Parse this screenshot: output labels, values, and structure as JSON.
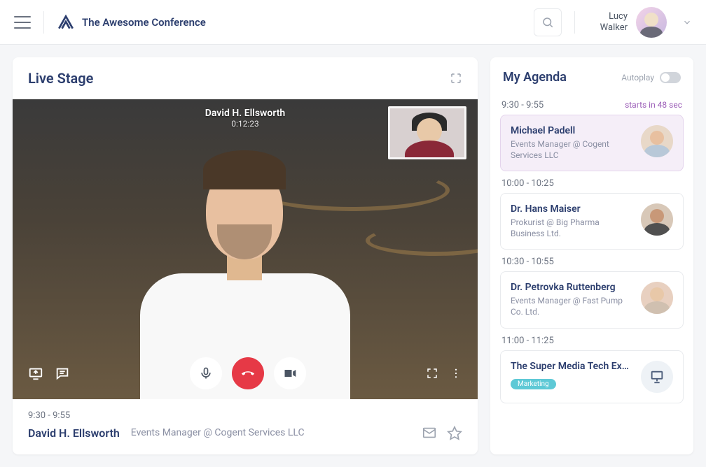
{
  "header": {
    "app_name": "The Awesome Conference",
    "user_first": "Lucy",
    "user_last": "Walker"
  },
  "stage": {
    "title": "Live Stage",
    "presenter_overlay_name": "David H. Ellsworth",
    "presenter_overlay_time": "0:12:23",
    "footer_time": "9:30 - 9:55",
    "footer_name": "David H. Ellsworth",
    "footer_title": "Events Manager @ Cogent Services LLC"
  },
  "agenda": {
    "title": "My Agenda",
    "autoplay_label": "Autoplay",
    "slots": [
      {
        "time": "9:30 - 9:55",
        "countdown": "starts in 48 sec",
        "active": true,
        "name": "Michael Padell",
        "sub": "Events Manager @ Cogent Services LLC",
        "avatar_bg": "#e8d8c8",
        "avatar_skin": "#e8c0a0",
        "avatar_body": "#b8c8d8"
      },
      {
        "time": "10:00 - 10:25",
        "name": "Dr. Hans Maiser",
        "sub": "Prokurist @ Big Pharma Business Ltd.",
        "avatar_bg": "#d8c8b8",
        "avatar_skin": "#c89878",
        "avatar_body": "#505050"
      },
      {
        "time": "10:30 - 10:55",
        "name": "Dr. Petrovka Ruttenberg",
        "sub": "Events Manager @ Fast Pump Co. Ltd.",
        "avatar_bg": "#e8d0c0",
        "avatar_skin": "#e8c8a8",
        "avatar_body": "#d0c0b0"
      },
      {
        "time": "11:00 - 11:25",
        "name": "The Super Media Tech Experiences",
        "is_session": true,
        "tag": "Marketing"
      }
    ]
  }
}
